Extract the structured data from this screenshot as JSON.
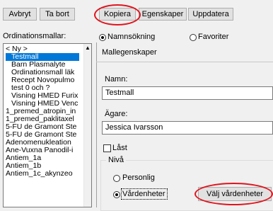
{
  "toolbar": {
    "buttons": [
      {
        "label": "Avbryt"
      },
      {
        "label": "Ta bort"
      },
      {
        "label": "Kopiera"
      },
      {
        "label": "Egenskaper"
      },
      {
        "label": "Uppdatera"
      }
    ]
  },
  "left_panel": {
    "label": "Ordinationsmallar:",
    "items": [
      "< Ny >",
      "Testmall",
      "Barn Plasmalyte",
      "Ordinationsmall läk",
      "Recept Novopulmo",
      "test 0 och ?",
      "Visning HMED Furix",
      "Visning HMED Venc",
      "1_premed_atropin_in",
      "1_premed_paklitaxel",
      "5-FU de Gramont Ste",
      "5-FU de Gramont Ste",
      "Adenomenukleation",
      "Ane-Vuxna Panodil-i",
      "Antiem_1a",
      "Antiem_1b",
      "Antiem_1c_akynzeo"
    ],
    "selected_index": 1
  },
  "search_mode": {
    "options": [
      {
        "label": "Namnsökning",
        "selected": true
      },
      {
        "label": "Favoriter",
        "selected": false
      }
    ]
  },
  "properties": {
    "title": "Mallegenskaper",
    "name_label": "Namn:",
    "name_value": "Testmall",
    "owner_label": "Ägare:",
    "owner_value": "Jessica Ivarsson",
    "locked_label": "Låst",
    "locked": false,
    "level_label": "Nivå",
    "level_options": [
      {
        "label": "Personlig",
        "selected": false
      },
      {
        "label": "Vårdenheter",
        "selected": true
      }
    ],
    "choose_units_button": "Välj vårdenheter"
  },
  "colors": {
    "highlight_circle": "#e0141e",
    "selection": "#0078d7"
  }
}
